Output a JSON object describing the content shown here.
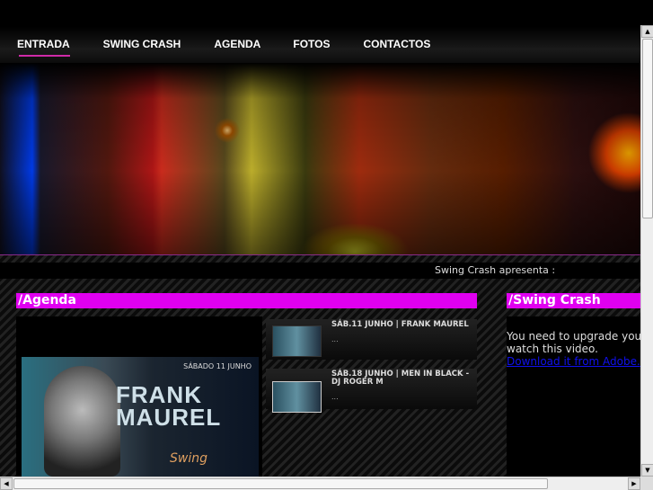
{
  "nav": [
    {
      "label": "ENTRADA",
      "active": true
    },
    {
      "label": "SWING CRASH"
    },
    {
      "label": "AGENDA"
    },
    {
      "label": "FOTOS"
    },
    {
      "label": "CONTACTOS"
    }
  ],
  "ticker": "Swing Crash apresenta :",
  "agenda": {
    "title": "/Agenda",
    "poster": {
      "date": "SÁBADO 11 JUNHO",
      "name": "FRANK MAUREL",
      "logo": "Swing"
    },
    "items": [
      {
        "title": "SÁB.11 JUNHO | FRANK MAUREL",
        "desc": "..."
      },
      {
        "title": "SÁB.18 JUNHO | MEN IN BLACK - DJ ROGER M",
        "desc": "..."
      }
    ]
  },
  "swing": {
    "title": "/Swing Crash",
    "line1": "You need to upgrade your",
    "line2": "watch this video.",
    "link": "Download it from Adobe."
  },
  "colors": {
    "accent": "#e000f0",
    "underline": "#d02aa8",
    "link": "#1010ee"
  }
}
